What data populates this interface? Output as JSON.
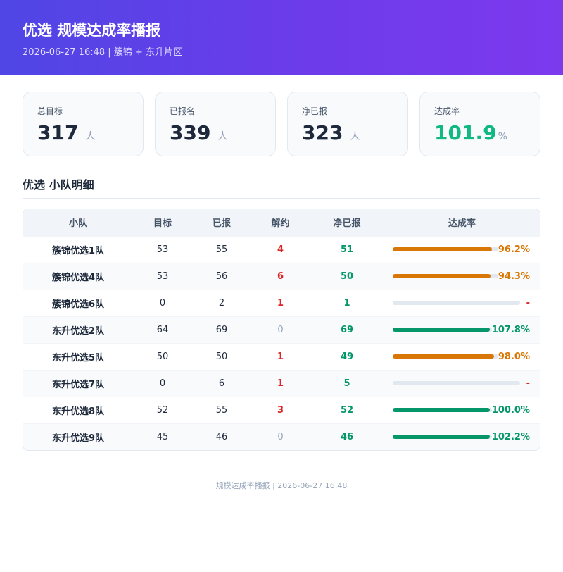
{
  "header": {
    "title": "优选 规模达成率播报",
    "subtitle": "2026-06-27 16:48 | 簇锦 + 东升片区"
  },
  "cards": [
    {
      "label": "总目标",
      "value": "317",
      "unit": "人"
    },
    {
      "label": "已报名",
      "value": "339",
      "unit": "人"
    },
    {
      "label": "净已报",
      "value": "323",
      "unit": "人"
    },
    {
      "label": "达成率",
      "value": "101.9",
      "unit": "%"
    }
  ],
  "section_title": "优选 小队明细",
  "table": {
    "columns": [
      "小队",
      "目标",
      "已报",
      "解约",
      "净已报",
      "达成率"
    ],
    "rows": [
      {
        "team": "簇锦优选1队",
        "target": "53",
        "reported": "55",
        "cancelled": "4",
        "net": "51",
        "rate": "96.2%",
        "rate_value": 96.2,
        "color": "#d97706"
      },
      {
        "team": "簇锦优选4队",
        "target": "53",
        "reported": "56",
        "cancelled": "6",
        "net": "50",
        "rate": "94.3%",
        "rate_value": 94.3,
        "color": "#d97706"
      },
      {
        "team": "簇锦优选6队",
        "target": "0",
        "reported": "2",
        "cancelled": "1",
        "net": "1",
        "rate": "-",
        "rate_value": 0,
        "color": "#dc2626"
      },
      {
        "team": "东升优选2队",
        "target": "64",
        "reported": "69",
        "cancelled": "0",
        "net": "69",
        "rate": "107.8%",
        "rate_value": 107.8,
        "color": "#059669"
      },
      {
        "team": "东升优选5队",
        "target": "50",
        "reported": "50",
        "cancelled": "1",
        "net": "49",
        "rate": "98.0%",
        "rate_value": 98.0,
        "color": "#d97706"
      },
      {
        "team": "东升优选7队",
        "target": "0",
        "reported": "6",
        "cancelled": "1",
        "net": "5",
        "rate": "-",
        "rate_value": 0,
        "color": "#dc2626"
      },
      {
        "team": "东升优选8队",
        "target": "52",
        "reported": "55",
        "cancelled": "3",
        "net": "52",
        "rate": "100.0%",
        "rate_value": 100.0,
        "color": "#059669"
      },
      {
        "team": "东升优选9队",
        "target": "45",
        "reported": "46",
        "cancelled": "0",
        "net": "46",
        "rate": "102.2%",
        "rate_value": 102.2,
        "color": "#059669"
      }
    ]
  },
  "footer": "规模达成率播报 | 2026-06-27 16:48",
  "colors": {
    "accent_start": "#4f46e5",
    "accent_end": "#7c3aed",
    "good": "#10b981",
    "warn": "#d97706",
    "bad": "#dc2626"
  }
}
